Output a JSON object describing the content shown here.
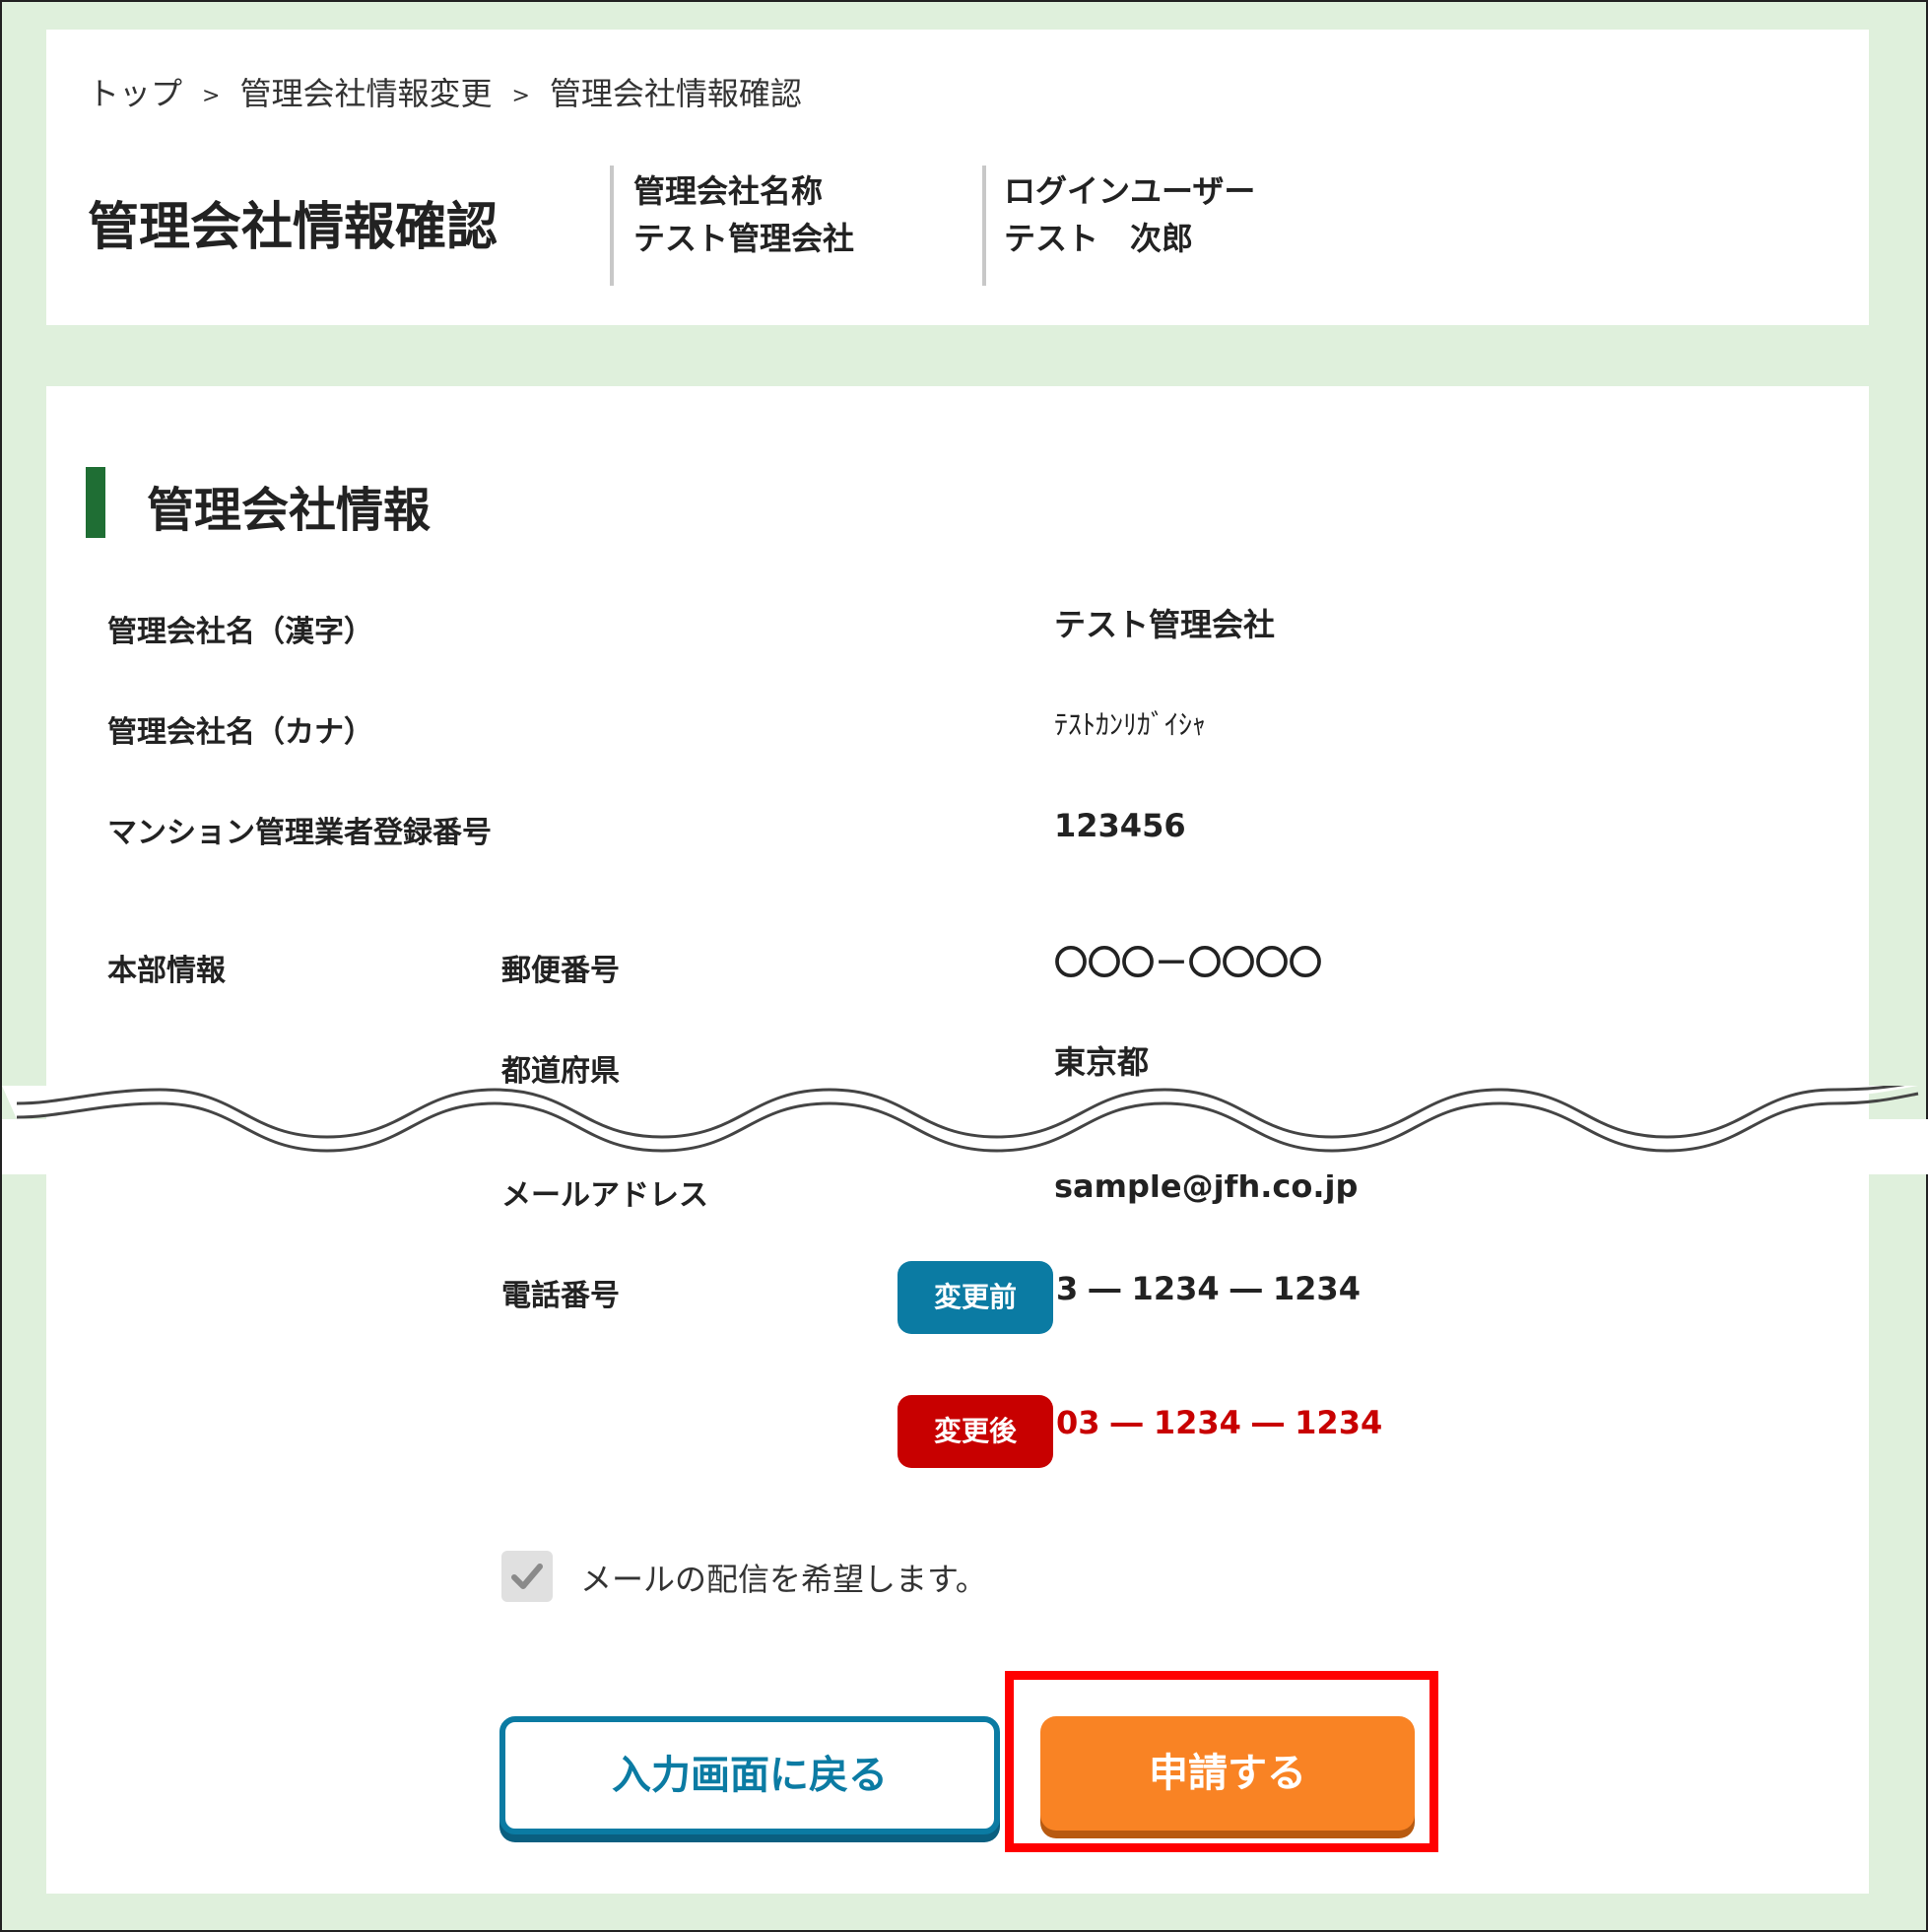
{
  "breadcrumb": {
    "items": [
      "トップ",
      "管理会社情報変更",
      "管理会社情報確認"
    ],
    "separator": ">"
  },
  "header": {
    "page_title": "管理会社情報確認",
    "company_label": "管理会社名称",
    "company_value": "テスト管理会社",
    "user_label": "ログインユーザー",
    "user_value": "テスト　次郎"
  },
  "section": {
    "title": "管理会社情報"
  },
  "fields": {
    "company_kanji_label": "管理会社名（漢字）",
    "company_kanji_value": "テスト管理会社",
    "company_kana_label": "管理会社名（カナ）",
    "company_kana_value": "ﾃｽﾄｶﾝﾘｶﾞｲｼｬ",
    "reg_number_label": "マンション管理業者登録番号",
    "reg_number_value": "123456",
    "hq_label": "本部情報",
    "postal_label": "郵便番号",
    "postal_value": "〇〇〇－〇〇〇〇",
    "prefecture_label": "都道府県",
    "prefecture_value": "東京都",
    "email_label": "メールアドレス",
    "email_value": "sample@jfh.co.jp",
    "phone_label": "電話番号",
    "before_badge": "変更前",
    "phone_before": "3 ― 1234 ― 1234",
    "after_badge": "変更後",
    "phone_after": "03 ― 1234 ― 1234"
  },
  "mail_opt_in": {
    "label": "メールの配信を希望します。",
    "checked": true
  },
  "buttons": {
    "back": "入力画面に戻る",
    "apply": "申請する"
  },
  "colors": {
    "background": "#dff0dc",
    "section_accent": "#1f6e34",
    "before_badge": "#0b7ba3",
    "after_badge": "#c80000",
    "apply_button": "#f98324",
    "highlight": "#ff0000"
  }
}
